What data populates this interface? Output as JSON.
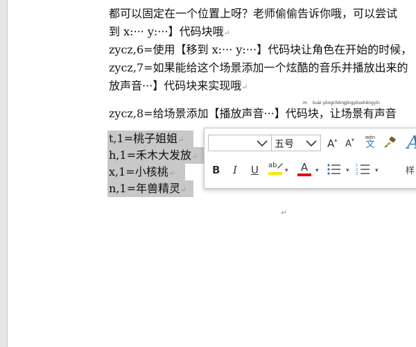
{
  "document": {
    "lines": [
      {
        "text": "都可以固定在一个位置上呀？老师偷偷告诉你哦，可以尝试",
        "top": 0
      },
      {
        "text": "到 x:···  y:···】代码块哦",
        "top": 0
      },
      {
        "text": "zycz,6=使用【移到 x:···  y:···】代码块让角色在开始的时候，",
        "top": 0
      },
      {
        "text": "zycz,7=如果能给这个场景添加一个炫酷的音乐并播放出来的",
        "top": 0
      },
      {
        "text": "放声音···】代码块来实现哦",
        "top": 0
      },
      {
        "text": "zycz,8=给场景添加【播放声音···】代码块，让场景有声音",
        "top": 0
      }
    ],
    "ruby_text": "kuài   yǒngchōngjīngyǒushēngyīn",
    "ruby_prefix": "m",
    "selected_lines": [
      "t,1=桃子姐姐",
      "h,1=禾木大发放",
      "x,1=小核桃",
      "n,1=年兽精灵"
    ],
    "paragraph_mark": "↵"
  },
  "mini_toolbar": {
    "font_name_value": "",
    "font_size_value": "五号",
    "grow_font_label": "A",
    "shrink_font_label": "A",
    "phonetic_guide_top": "wén",
    "phonetic_guide_char": "文",
    "bold_label": "B",
    "italic_label": "I",
    "underline_label": "U",
    "highlight_label": "ab",
    "font_color_label": "A",
    "styles_label": "样",
    "styles_glyph": "A",
    "highlight_color": "#f5e800",
    "font_color": "#e00000",
    "accent_color": "#2e75b6"
  }
}
